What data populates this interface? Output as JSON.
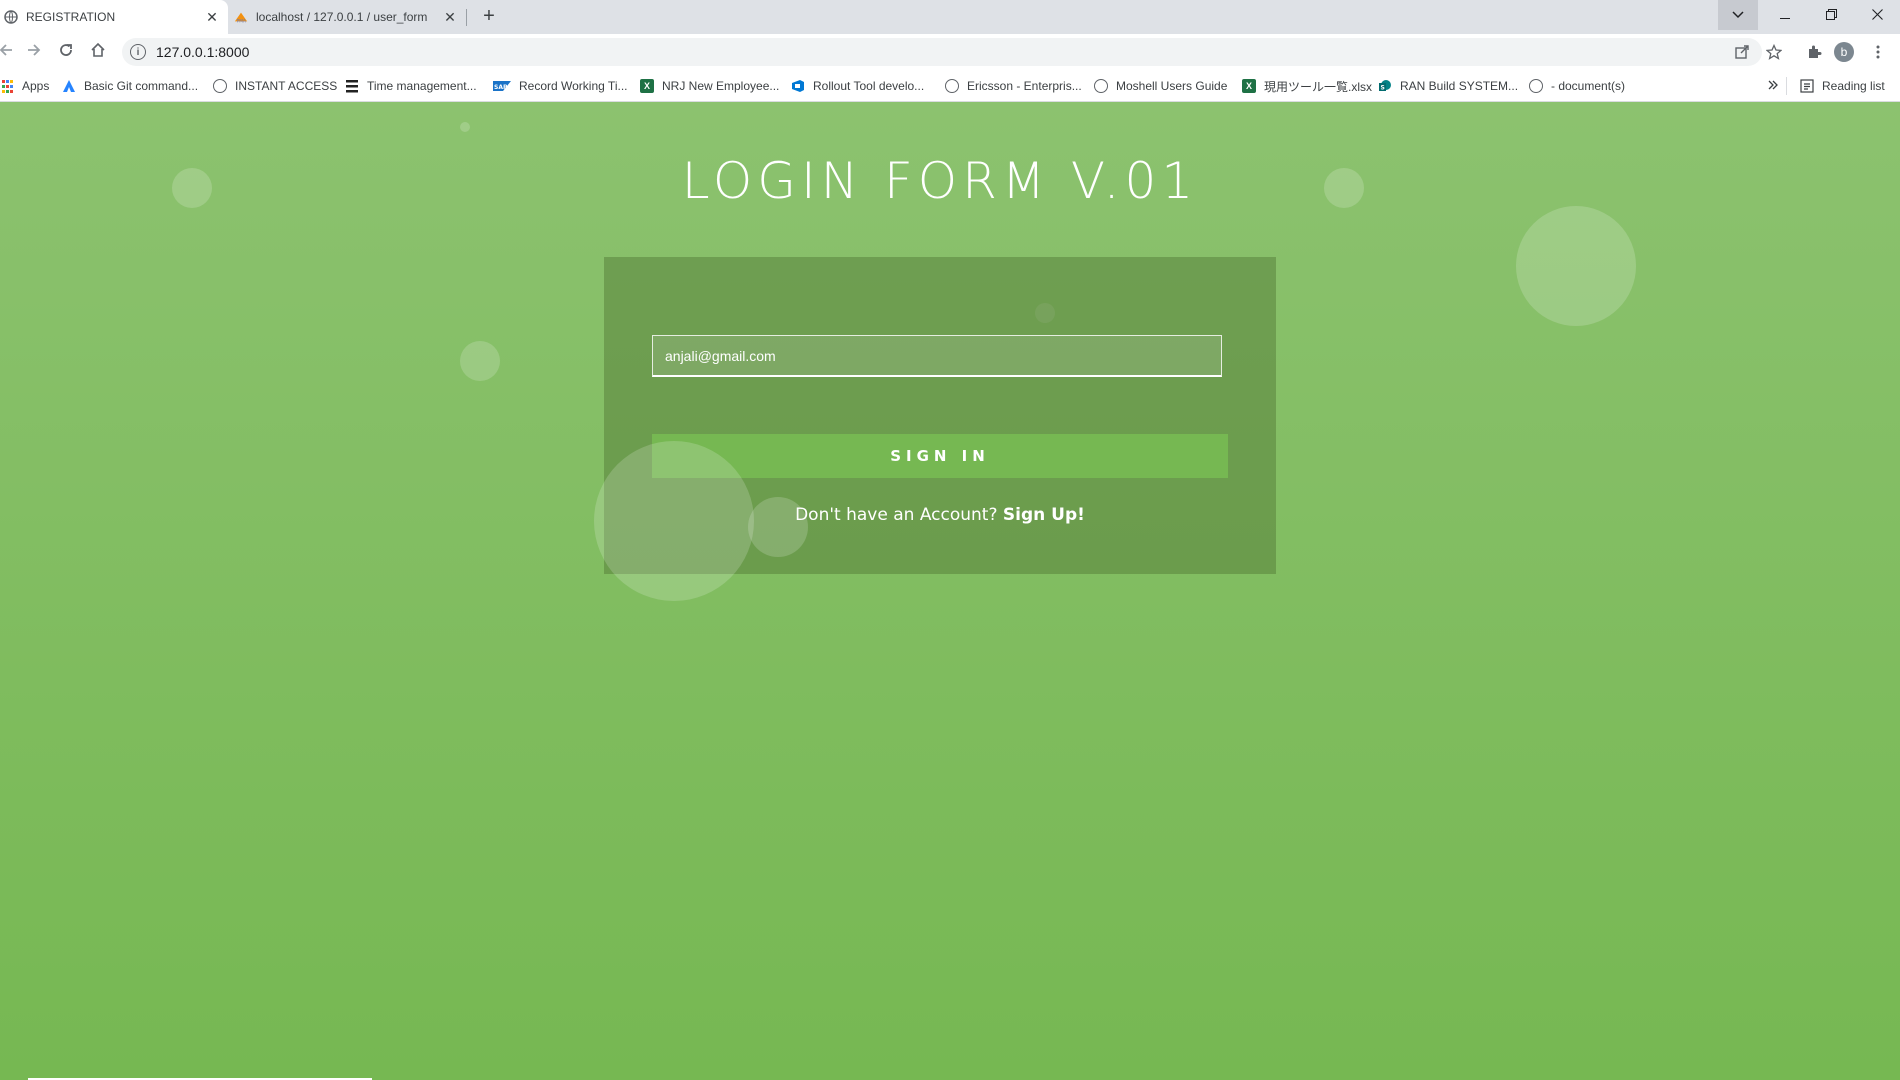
{
  "browser": {
    "tabs": [
      {
        "title": "REGISTRATION",
        "active": true,
        "favicon": "globe-icon"
      },
      {
        "title": "localhost / 127.0.0.1 / user_form",
        "active": false,
        "favicon": "phpmyadmin-icon"
      }
    ],
    "url": "127.0.0.1:8000",
    "profile_initial": "b",
    "reading_list_label": "Reading list"
  },
  "bookmarks": [
    {
      "label": "Apps",
      "icon": "apps-grid-icon"
    },
    {
      "label": "Basic Git command...",
      "icon": "atlassian-icon"
    },
    {
      "label": "INSTANT ACCESS",
      "icon": "globe-icon"
    },
    {
      "label": "Time management...",
      "icon": "stack-icon"
    },
    {
      "label": "Record Working Ti...",
      "icon": "sap-icon"
    },
    {
      "label": "NRJ New Employee...",
      "icon": "excel-icon"
    },
    {
      "label": "Rollout Tool develo...",
      "icon": "azure-devops-icon"
    },
    {
      "label": "Ericsson - Enterpris...",
      "icon": "globe-icon"
    },
    {
      "label": "Moshell Users Guide",
      "icon": "globe-icon"
    },
    {
      "label": "現用ツール一覧.xlsx",
      "icon": "excel-icon"
    },
    {
      "label": "RAN Build SYSTEM...",
      "icon": "sharepoint-icon"
    },
    {
      "label": "- document(s)",
      "icon": "globe-icon"
    }
  ],
  "page": {
    "title": "LOGIN FORM V.01",
    "email_value": "anjali@gmail.com",
    "signin_label": "SIGN IN",
    "signup_prompt": "Don't have an Account?",
    "signup_link": "Sign Up!"
  },
  "colors": {
    "page_top": "#8cc26f",
    "page_bottom": "#76b852",
    "button": "#76b852"
  }
}
